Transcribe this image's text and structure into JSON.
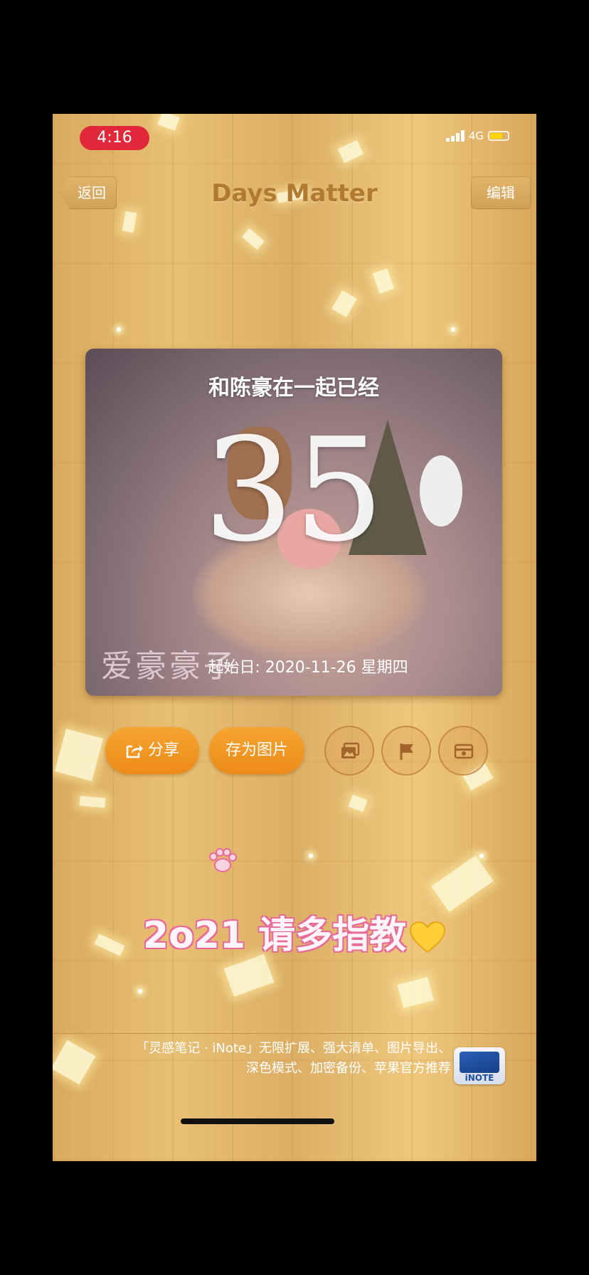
{
  "status_bar": {
    "time": "4:16",
    "network": "4G"
  },
  "nav": {
    "back_label": "返回",
    "title": "Days Matter",
    "edit_label": "编辑"
  },
  "card": {
    "caption": "和陈豪在一起已经",
    "days": "35",
    "signature": "爱豪豪子",
    "start_date": "起始日: 2020-11-26 星期四"
  },
  "actions": {
    "share_label": "分享",
    "save_label": "存为图片"
  },
  "promo_text": "2o21 请多指教",
  "ad": {
    "line1": "「灵感笔记 · iNote」无限扩展、强大清单、图片导出、",
    "line2": "深色模式、加密备份、苹果官方推荐",
    "logo_label": "iNOTE"
  },
  "colors": {
    "accent": "#ec8a17",
    "wood": "#e2b56c",
    "title": "#b07a32",
    "time_pill": "#e0283a"
  },
  "icons": [
    "share-icon",
    "photo-icon",
    "flag-icon",
    "card-icon",
    "paw-icon",
    "heart-icon"
  ]
}
